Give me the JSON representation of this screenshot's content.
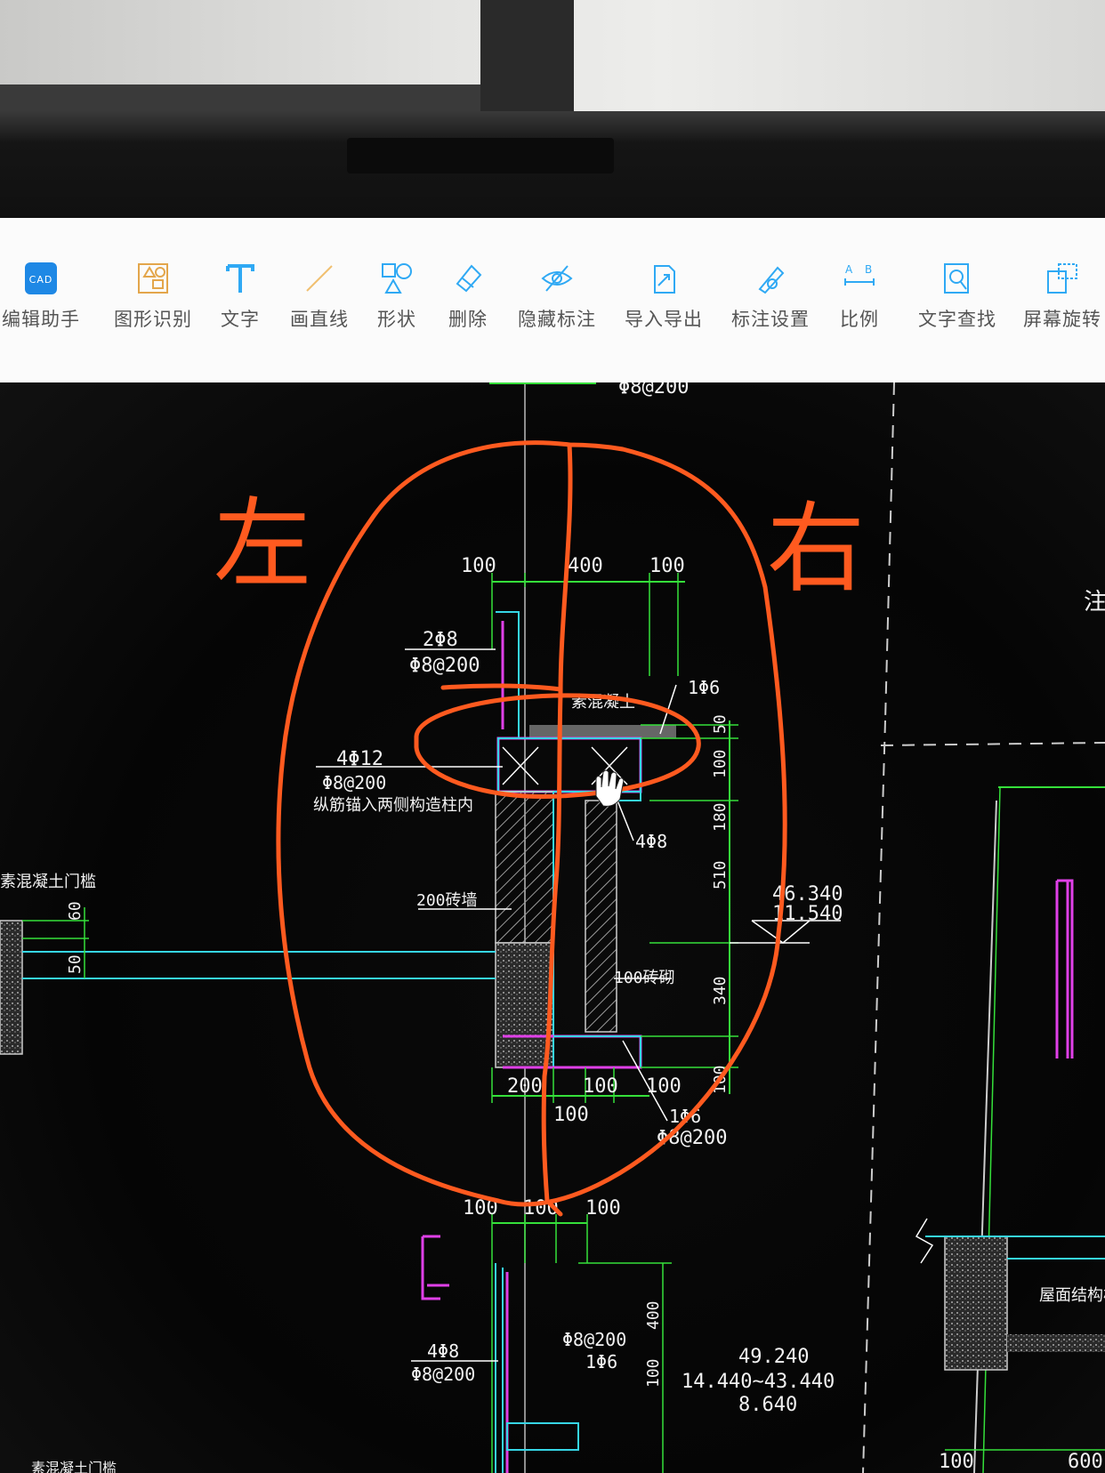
{
  "toolbar": {
    "items": [
      {
        "label": "编辑助手",
        "icon": "app-logo-icon"
      },
      {
        "label": "图形识别",
        "icon": "shape-recognize-icon"
      },
      {
        "label": "文字",
        "icon": "text-icon"
      },
      {
        "label": "画直线",
        "icon": "line-icon"
      },
      {
        "label": "形状",
        "icon": "shape-icon"
      },
      {
        "label": "删除",
        "icon": "eraser-icon"
      },
      {
        "label": "隐藏标注",
        "icon": "hide-annotation-icon"
      },
      {
        "label": "导入导出",
        "icon": "import-export-icon"
      },
      {
        "label": "标注设置",
        "icon": "annotation-settings-icon"
      },
      {
        "label": "比例",
        "icon": "scale-icon"
      },
      {
        "label": "文字查找",
        "icon": "text-search-icon"
      },
      {
        "label": "屏幕旋转",
        "icon": "screen-rotate-icon"
      }
    ]
  },
  "drawing": {
    "top_rebar": "Φ8@200",
    "dim_100_left": "100",
    "dim_400": "400",
    "dim_100_right": "100",
    "rebar_2phi8": "2Φ8",
    "rebar_phi8_200_a": "Φ8@200",
    "label_concrete": "素混凝土",
    "rebar_1phi6": "1Φ6",
    "dim_50": "50",
    "dim_100_v": "100",
    "rebar_4phi12": "4Φ12",
    "rebar_phi8_200_b": "Φ8@200",
    "note_anchor": "纵筋锚入两侧构造柱内",
    "dim_180": "180",
    "rebar_4phi8_a": "4Φ8",
    "dim_510": "510",
    "elev_1": "46.340",
    "elev_2": "11.540",
    "label_200_wall": "200砖墙",
    "label_left_sill": "素混凝土门槛",
    "dim_60": "60",
    "dim_50_left": "50",
    "label_100_wall": "100砖砌",
    "dim_340": "340",
    "dim_200_b": "200",
    "dim_100_b1": "100",
    "dim_100_b2": "100",
    "dim_100_b3": "100",
    "dim_100_v2": "100",
    "rebar_1phi6_b": "1Φ6",
    "rebar_phi8_200_c": "Φ8@200",
    "dim_100_c1": "100",
    "dim_100_c2": "100",
    "dim_100_c3": "100",
    "rebar_4phi8_b": "4Φ8",
    "rebar_phi8_200_d": "Φ8@200",
    "rebar_phi8_200_e": "Φ8@200",
    "rebar_1phi6_c": "1Φ6",
    "dim_100_v3": "100",
    "dim_400_v": "400",
    "elev_3": "49.240",
    "elev_4": "14.440~43.440",
    "elev_5": "8.640",
    "label_roof": "屋面结构板",
    "dim_100_br": "100",
    "dim_600": "600",
    "label_zhu": "注",
    "label_bottom_left": "素混凝土门槛"
  },
  "handwriting": {
    "left": "左",
    "right": "右"
  },
  "colors": {
    "annotation": "#ff5a1f",
    "dim_green": "#35e03a",
    "cyan": "#36d6e6",
    "magenta": "#e040e8",
    "text": "#f2f2f2"
  }
}
